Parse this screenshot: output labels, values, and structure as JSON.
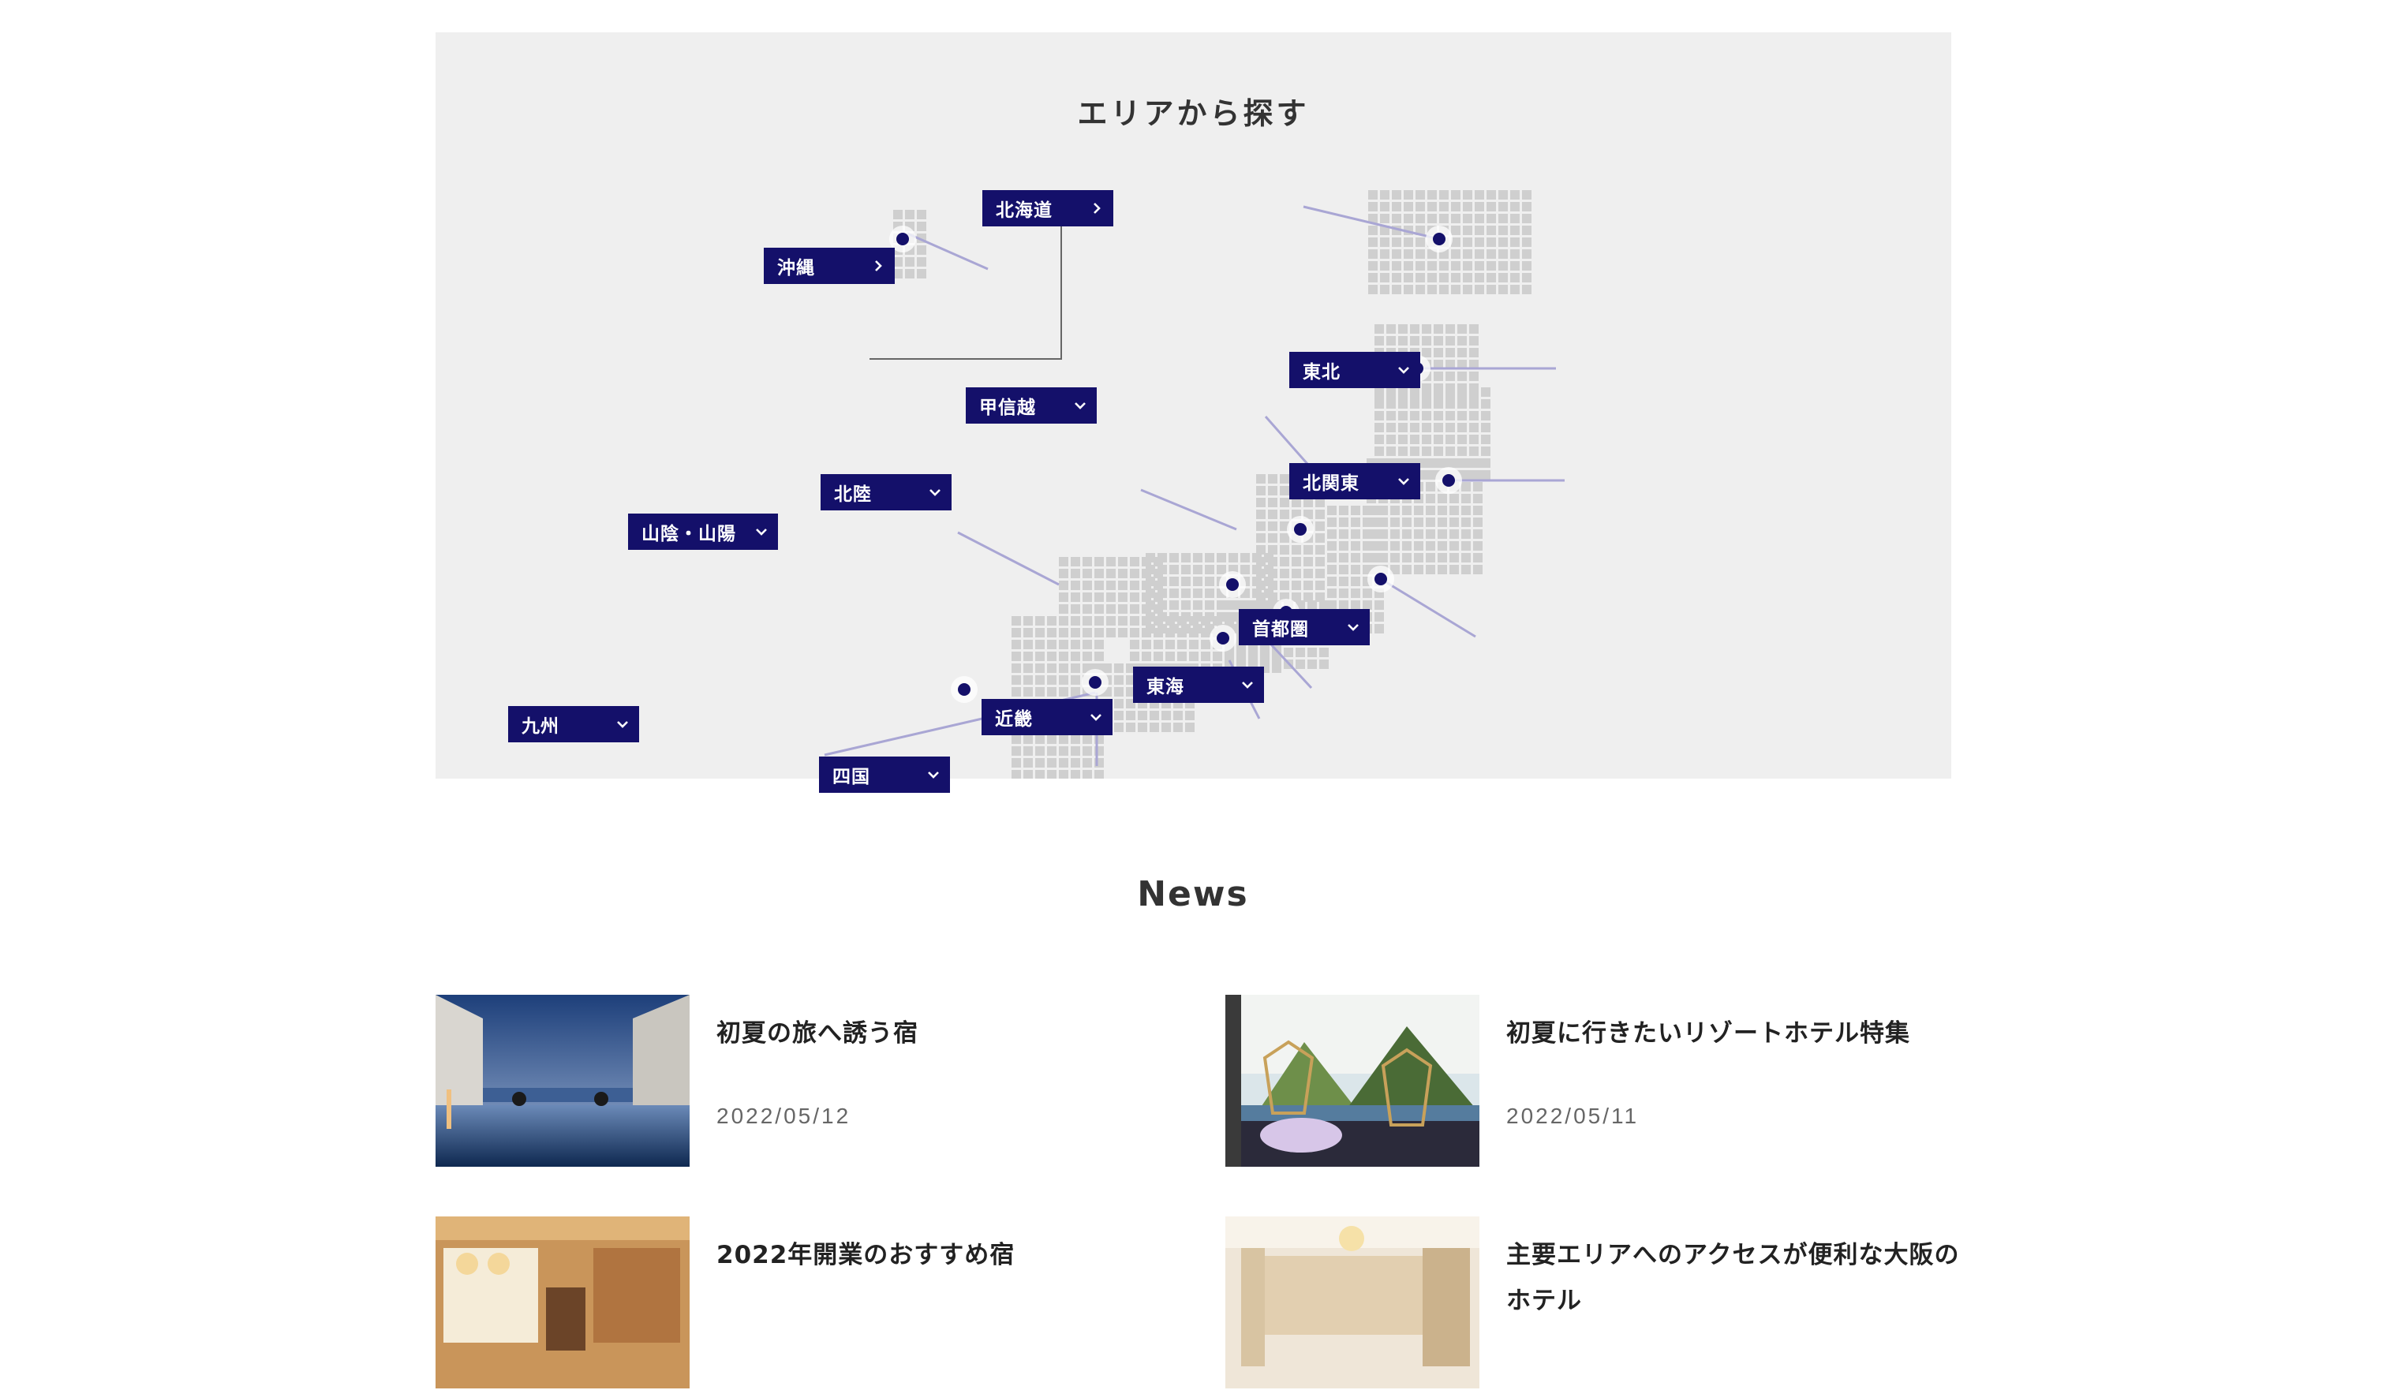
{
  "area_search": {
    "title": "エリアから探す",
    "regions": [
      {
        "key": "hokkaido",
        "label": "北海道",
        "chevron": "right"
      },
      {
        "key": "okinawa",
        "label": "沖縄",
        "chevron": "right"
      },
      {
        "key": "tohoku",
        "label": "東北",
        "chevron": "down"
      },
      {
        "key": "koshinetsu",
        "label": "甲信越",
        "chevron": "down"
      },
      {
        "key": "kitakanto",
        "label": "北関東",
        "chevron": "down"
      },
      {
        "key": "hokuriku",
        "label": "北陸",
        "chevron": "down"
      },
      {
        "key": "sanin_sanyo",
        "label": "山陰・山陽",
        "chevron": "down"
      },
      {
        "key": "shutoken",
        "label": "首都圏",
        "chevron": "down"
      },
      {
        "key": "tokai",
        "label": "東海",
        "chevron": "down"
      },
      {
        "key": "kinki",
        "label": "近畿",
        "chevron": "down"
      },
      {
        "key": "kyushu",
        "label": "九州",
        "chevron": "down"
      },
      {
        "key": "shikoku",
        "label": "四国",
        "chevron": "down"
      }
    ],
    "colors": {
      "button": "#14106a",
      "dot": "#14106a",
      "map_cell": "#cfcfcf",
      "leader_line": "#a9a6d4",
      "background": "#efefef"
    }
  },
  "news": {
    "title": "News",
    "items": [
      {
        "headline": "初夏の旅へ誘う宿",
        "date": "2022/05/12"
      },
      {
        "headline": "初夏に行きたいリゾートホテル特集",
        "date": "2022/05/11"
      },
      {
        "headline": "2022年開業のおすすめ宿",
        "date": ""
      },
      {
        "headline": "主要エリアへのアクセスが便利な大阪のホテル",
        "date": ""
      }
    ]
  }
}
